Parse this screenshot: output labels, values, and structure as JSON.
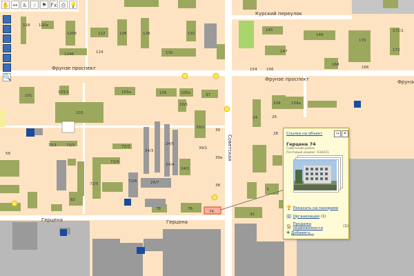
{
  "toolbar": {
    "buttons": [
      {
        "icon": "pan-tool-icon",
        "glyph": "✋"
      },
      {
        "icon": "ruler-icon",
        "glyph": "↔"
      },
      {
        "icon": "accessibility-icon",
        "glyph": "♿"
      },
      {
        "icon": "hand-icon",
        "glyph": "☝"
      },
      {
        "icon": "flag-icon",
        "glyph": "⚑"
      },
      {
        "icon": "fx-icon",
        "glyph": "Fx"
      },
      {
        "icon": "print-icon",
        "glyph": "⎙"
      },
      {
        "icon": "bulb-icon",
        "glyph": "💡"
      }
    ]
  },
  "zoom": {
    "levels": 6,
    "active_from": 0
  },
  "streets": {
    "frunze_left": "Фрунзе проспект",
    "frunze_right": "Фрунзе проспект",
    "kursky": "Курский переулок",
    "gertsena_left": "Герцена",
    "gertsena_mid": "Герцена",
    "sovetskaya": "Советская",
    "frunze_partial": "Фрунзе про"
  },
  "houses": {
    "h118": "118",
    "h120a": "120а",
    "h120b": "120б",
    "h122": "122",
    "h124": "124",
    "h126": "126",
    "h128": "128",
    "h130": "130",
    "h132": "132",
    "h124b": "124б",
    "h145": "145",
    "h147": "147",
    "h149": "149",
    "h168": "168",
    "h170": "170",
    "h172": "172",
    "h172_1": "172/1",
    "h154": "154",
    "h156": "156",
    "h166": "166",
    "h101": "101",
    "h103": "103",
    "h103_1": "103/1",
    "h103a": "103а",
    "h105": "105",
    "h105a": "105а",
    "h37": "37",
    "h10_1": "10/1",
    "h109": "109",
    "h109a": "109а",
    "h24": "24",
    "h26": "26",
    "h28": "28",
    "h39_1": "39/1",
    "h39_2": "39/2",
    "h39": "39",
    "h39a": "39а",
    "h38": "38",
    "h72_1": "72/1",
    "h72_2": "72/2",
    "h72_3": "72/3",
    "h72_4": "72/4",
    "h72_5": "72/5",
    "h72_6": "72/6",
    "h24_3": "24/3",
    "h24_5": "24/5",
    "h24_7": "24/7",
    "h24_4": "24/4",
    "h24_1": "24/1",
    "h74": "74",
    "h76": "76",
    "h78": "78",
    "h82": "82",
    "h58": "58",
    "h32": "32",
    "h3": "3"
  },
  "popup": {
    "link_label": "Ссылка на объект",
    "title": "Герцена 74",
    "district": "Советский район",
    "postal": "Почтовый индекс: 634021",
    "actions": [
      {
        "icon": "panorama-icon",
        "glyph": "🏆",
        "label": "Показать на панораме",
        "count": "",
        "color": "#9a6b00"
      },
      {
        "icon": "organization-icon",
        "glyph": "🏢",
        "label": "Организации",
        "count": "(1)",
        "color": "#c0392b"
      },
      {
        "icon": "realty-icon",
        "glyph": "🏠",
        "label": "Продажа недвижимости",
        "count": "(1)",
        "color": "#d35400"
      },
      {
        "icon": "add-icon",
        "glyph": "✚",
        "label": "Добавить...",
        "count": "",
        "color": "#2e8b2e"
      }
    ]
  },
  "colors": {
    "block_bg": "#fde3c2",
    "building": "#9da85f",
    "building_dark": "#8a8a8a",
    "road": "#ffffff",
    "park": "#a8d66a",
    "popup_bg": "#fffbd6",
    "marker_yellow": "#ffe84a",
    "selected_building": "#e05a3a"
  }
}
